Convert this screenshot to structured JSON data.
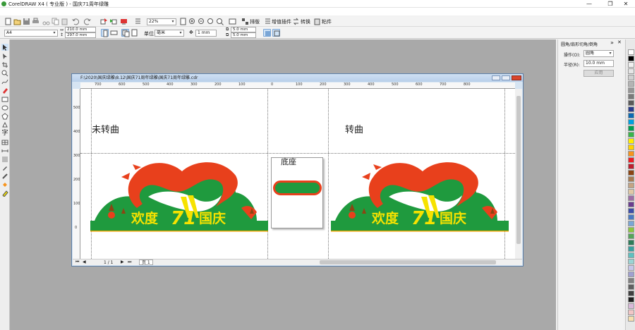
{
  "window": {
    "title": "CorelDRAW X4 ( 专业版 ) - 国庆71周年绿雕",
    "min": "—",
    "max": "❐",
    "close": "✕"
  },
  "toolbar": {
    "zoom": "22%",
    "arrange": "排版",
    "plugins": "增值插件",
    "convert": "转换",
    "paste": "粘件"
  },
  "property_bar": {
    "paper": "A4",
    "width": "210.0 mm",
    "height": "297.0 mm",
    "units_label": "单位:",
    "units": "毫米",
    "nudge": "1 mm",
    "dup_x": "5.0 mm",
    "dup_y": "5.0 mm"
  },
  "docker": {
    "title": "圆角/扇形切角/倒角",
    "operation_label": "操作(O):",
    "operation_value": "圆角",
    "radius_label": "半径(R):",
    "radius_value": "10.0 mm",
    "apply": "应用"
  },
  "document": {
    "title": "F:\\2020\\国庆绿雕\\8.12\\国庆71周年绿雕\\国庆71周年绿雕.cdr",
    "ruler_top": [
      "700",
      "600",
      "500",
      "400",
      "300",
      "200",
      "100",
      "0",
      "100",
      "200",
      "300",
      "400",
      "500",
      "600",
      "700",
      "800"
    ],
    "ruler_left": [
      "500",
      "400",
      "300",
      "200",
      "100",
      "0"
    ],
    "left_label": "未转曲",
    "right_label": "转曲",
    "center_label": "底座",
    "sculpture_text_left": "欢度",
    "sculpture_text_right": "国庆",
    "sculpture_number": "71",
    "page_nav": "1 / 1",
    "page_tab": "页 1"
  },
  "palette_colors": [
    "#ffffff",
    "#000000",
    "#f0f0f0",
    "#e6e6e6",
    "#d0d0d0",
    "#b4b4b4",
    "#969696",
    "#7a7a7a",
    "#5a5a5a",
    "#2a3c8c",
    "#0b6ab4",
    "#00a0e0",
    "#00a050",
    "#39b54a",
    "#ffee00",
    "#ffd200",
    "#f7941d",
    "#ed1c24",
    "#be1e2d",
    "#8b4513",
    "#a67c52",
    "#c4a484",
    "#e0c9a6",
    "#9e6fa6",
    "#6a3d8f",
    "#3d4ea8",
    "#4b7ac2",
    "#7aa6d6",
    "#8cc63f",
    "#56a45a",
    "#2e7d5a",
    "#3aa0a0",
    "#5fc0c0",
    "#9ad4d4",
    "#c6c6e8",
    "#a0a0d0",
    "#808080",
    "#606060",
    "#404040",
    "#202020",
    "#d8b8d8",
    "#f2c6c6",
    "#f7e0b0"
  ],
  "colors": {
    "green": "#1f9a3e",
    "red": "#e8401c",
    "yellow": "#f6e200"
  }
}
